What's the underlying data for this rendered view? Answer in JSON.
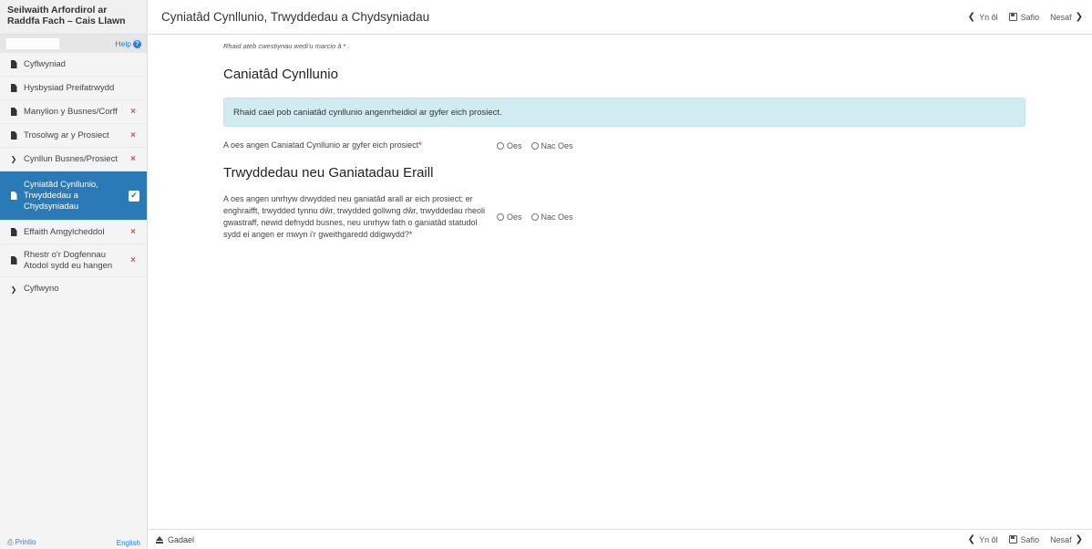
{
  "app": {
    "title": "Seilwaith Arfordirol ar Raddfa Fach – Cais Llawn",
    "help_label": "Help"
  },
  "sidebar": {
    "items": [
      {
        "label": "Cyflwyniad",
        "icon": "document-icon",
        "status": ""
      },
      {
        "label": "Hysbysiad Preifatrwydd",
        "icon": "document-icon",
        "status": ""
      },
      {
        "label": "Manylion y Busnes/Corff",
        "icon": "document-icon",
        "status": "×"
      },
      {
        "label": "Trosolwg ar y Prosiect",
        "icon": "document-icon",
        "status": "×"
      },
      {
        "label": "Cynllun Busnes/Prosiect",
        "icon": "chevron-right-icon",
        "status": "×"
      },
      {
        "label": "Cyniatâd Cynllunio, Trwyddedau a Chydsyniadau",
        "icon": "document-icon",
        "status": "✔",
        "active": true
      },
      {
        "label": "Effaith Amgylcheddol",
        "icon": "document-icon",
        "status": "×"
      },
      {
        "label": "Rhestr o'r Dogfennau Atodol sydd eu hangen",
        "icon": "document-icon",
        "status": "×"
      },
      {
        "label": "Cyflwyno",
        "icon": "chevron-right-icon",
        "status": ""
      }
    ],
    "footer": {
      "print_label": "Printio",
      "language_label": "English"
    }
  },
  "header": {
    "title": "Cyniatâd Cynllunio, Trwyddedau a Chydsyniadau",
    "back_label": "Yn ôl",
    "save_label": "Safio",
    "next_label": "Nesaf"
  },
  "main": {
    "required_note": "Rhaid ateb cwestiynau wedi'u marcio â",
    "required_note_star": "*",
    "required_note_end": ".",
    "section1_title": "Caniatâd Cynllunio",
    "alert_text": "Rhaid cael pob caniatâd cynllunio angenrheidiol ar gyfer eich prosiect.",
    "q1_text": "A oes angen Caniatad Cynllunio ar gyfer eich prosiect",
    "section2_title": "Trwyddedau neu Ganiatadau Eraill",
    "q2_text": "A oes angen unrhyw drwydded neu ganiatâd arall ar eich prosiect; er enghraifft, trwydded tynnu dŵr, trwydded gollwng dŵr, trwyddedau rheoli gwastraff, newid defnydd busnes, neu unrhyw fath o ganiatâd statudol sydd ei angen er mwyn i'r gweithgaredd ddigwydd?",
    "required_star": "*",
    "option_yes": "Oes",
    "option_no": "Nac Oes"
  },
  "footer": {
    "exit_label": "Gadael",
    "back_label": "Yn ôl",
    "save_label": "Safio",
    "next_label": "Nesaf"
  },
  "colors": {
    "active_nav": "#2a7ab8",
    "alert_bg": "#d1ecf1",
    "error_mark": "#d9534f",
    "link": "#2a7fd4"
  }
}
